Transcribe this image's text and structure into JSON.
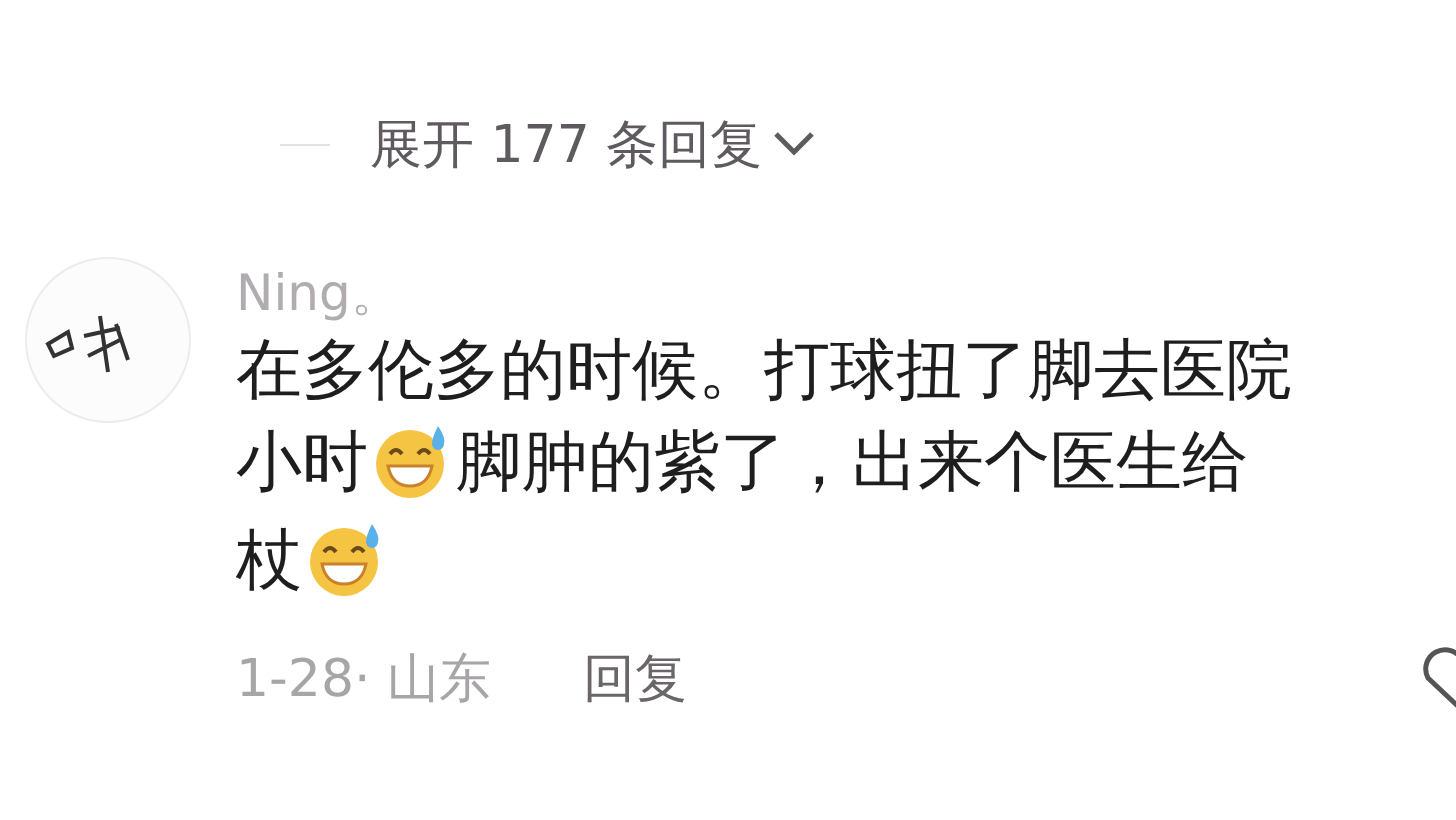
{
  "replies_toggle": {
    "label": "展开 177 条回复",
    "expanded": false
  },
  "comment": {
    "author": "Ning。",
    "lines": [
      [
        {
          "kind": "text",
          "text": "在多伦多的时候。打球扭了脚去医院"
        }
      ],
      [
        {
          "kind": "text",
          "text": "小时"
        },
        {
          "kind": "emoji"
        },
        {
          "kind": "text",
          "text": "脚肿的紫了，出来个医生给"
        }
      ],
      [
        {
          "kind": "text",
          "text": "杖"
        },
        {
          "kind": "emoji"
        }
      ]
    ],
    "date_location": "1-28· 山东",
    "reply_label": "回复"
  }
}
